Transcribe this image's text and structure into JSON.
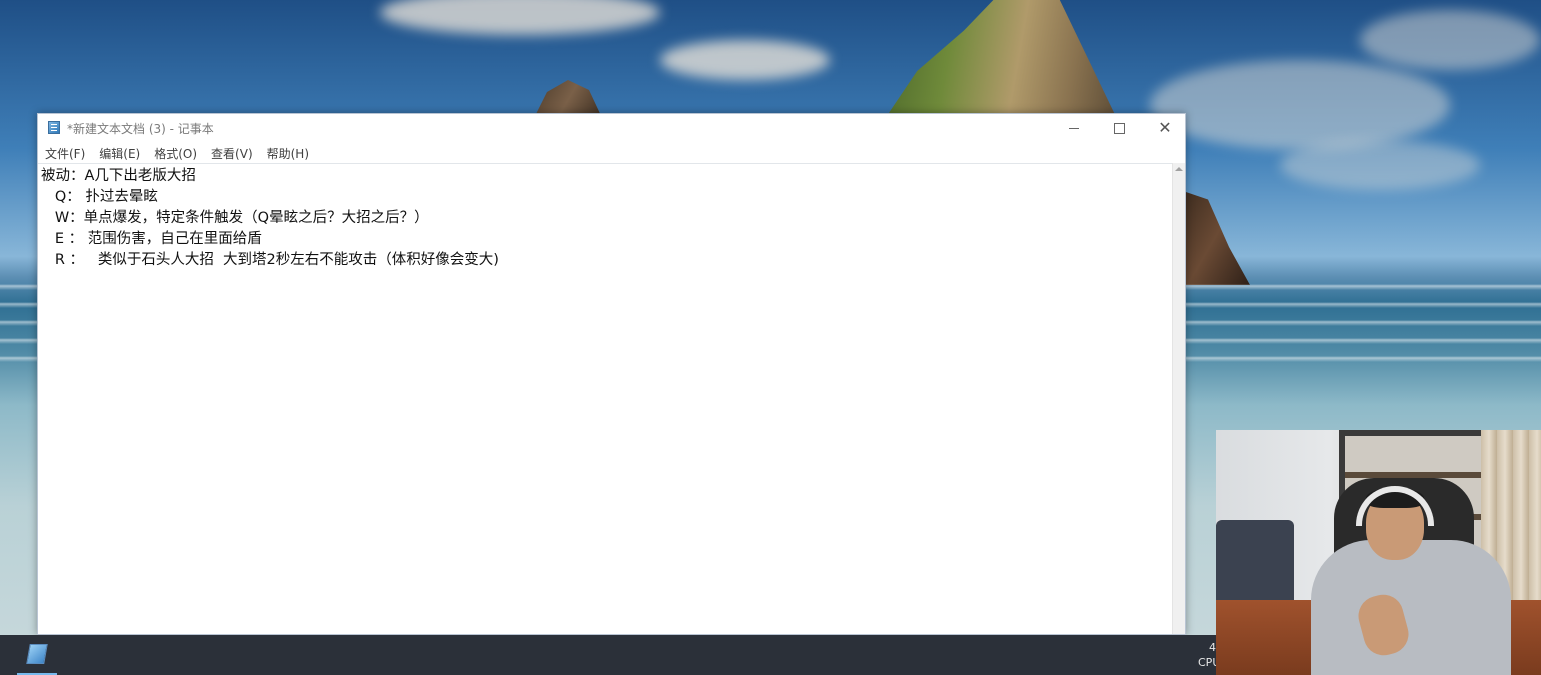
{
  "window": {
    "title": "*新建文本文档 (3) - 记事本",
    "icon": "notepad-icon",
    "controls": {
      "minimize": "minimize-icon",
      "maximize": "maximize-icon",
      "close": "close-icon"
    }
  },
  "menu": {
    "items": [
      {
        "label": "文件(F)"
      },
      {
        "label": "编辑(E)"
      },
      {
        "label": "格式(O)"
      },
      {
        "label": "查看(V)"
      },
      {
        "label": "帮助(H)"
      }
    ]
  },
  "document": {
    "lines": [
      "被动：A几下出老版大招",
      "   Q： 扑过去晕眩",
      "   W：单点爆发，特定条件触发（Q晕眩之后？大招之后？）",
      "   E ： 范围伤害，自己在里面给盾",
      "   R ：   类似于石头人大招  大到塔2秒左右不能攻击（体积好像会变大)"
    ]
  },
  "taskbar": {
    "pinned": [
      {
        "name": "notepad",
        "icon": "notepad-icon",
        "active": true
      }
    ],
    "tray_text_line1": "4",
    "tray_text_line2": "CPU"
  },
  "colors": {
    "taskbar_bg": "#2b3039",
    "active_indicator": "#76b9ed",
    "title_text": "#7a7a7a"
  }
}
